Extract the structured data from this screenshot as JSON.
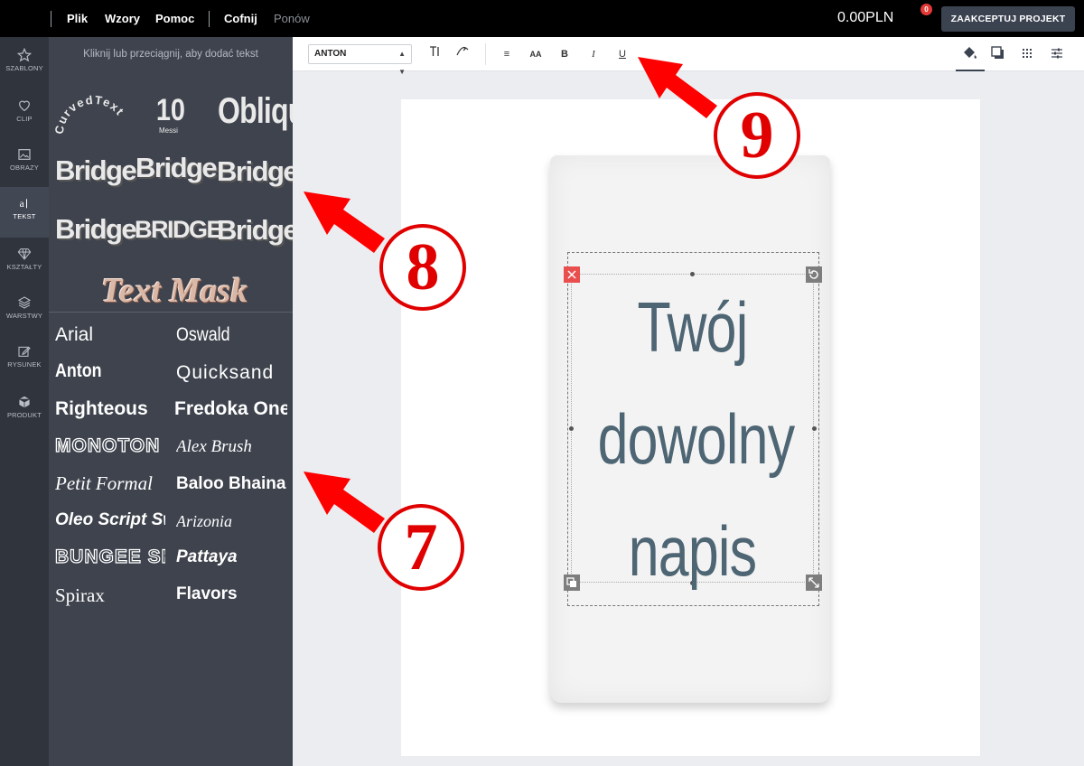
{
  "topbar": {
    "menu": [
      "Plik",
      "Wzory",
      "Pomoc"
    ],
    "undo": "Cofnij",
    "redo": "Ponów",
    "price": "0.00PLN",
    "cart_count": "0",
    "accept_label": "ZAAKCEPTUJ PROJEKT"
  },
  "rail": {
    "items": [
      {
        "label": "SZABLONY",
        "icon": "star-icon"
      },
      {
        "label": "CLIP",
        "icon": "heart-icon"
      },
      {
        "label": "OBRAZY",
        "icon": "image-icon"
      },
      {
        "label": "TEKST",
        "icon": "text-icon"
      },
      {
        "label": "KSZTAŁTY",
        "icon": "diamond-icon"
      },
      {
        "label": "WARSTWY",
        "icon": "layers-icon"
      },
      {
        "label": "RYSUNEK",
        "icon": "pencil-icon"
      },
      {
        "label": "PRODUKT",
        "icon": "box-icon"
      }
    ]
  },
  "panel": {
    "hint": "Kliknij lub przeciągnij, aby dodać tekst",
    "presets": {
      "curved": "CurvedText",
      "number": "10",
      "number_sub": "Messi",
      "oblique": "Oblique",
      "bridge": [
        "Bridge",
        "Bridge",
        "Bridge",
        "Bridge",
        "BRIDGE",
        "Bridge"
      ],
      "mask": "Text Mask"
    },
    "fonts": [
      "Arial",
      "Oswald",
      "Anton",
      "Quicksand",
      "Righteous",
      "Fredoka One",
      "MONOTON",
      "Alex Brush",
      "Petit Formal",
      "Baloo Bhaina",
      "Oleo Script Swash",
      "Arizonia",
      "BUNGEE SHADE",
      "Pattaya",
      "Spirax",
      "Flavors"
    ]
  },
  "toolbar": {
    "font": "ANTON",
    "align": "≡",
    "size": "AA",
    "bold": "B",
    "italic": "I",
    "underline": "U"
  },
  "design": {
    "lines": [
      "Twój",
      "dowolny",
      "napis"
    ]
  },
  "annotations": [
    "9",
    "8",
    "7"
  ],
  "colors": {
    "topbar": "#000000",
    "rail": "#2f343d",
    "panel": "#3e434d",
    "text": "#4e6574",
    "annotation": "#e00000"
  }
}
